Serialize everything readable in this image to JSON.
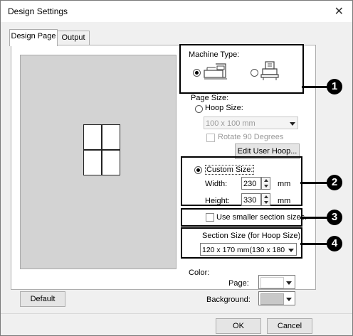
{
  "window": {
    "title": "Design Settings",
    "close_glyph": "✕"
  },
  "tabs": [
    {
      "label": "Design Page"
    },
    {
      "label": "Output"
    }
  ],
  "machine": {
    "label": "Machine Type:"
  },
  "page_size": {
    "label": "Page Size:",
    "hoop_label": "Hoop Size:",
    "hoop_value": "100 x 100 mm",
    "rotate_label": "Rotate 90 Degrees",
    "edit_hoop_button": "Edit User Hoop...",
    "custom_label": "Custom Size:",
    "width_label": "Width:",
    "width_value": "230",
    "height_label": "Height:",
    "height_value": "330",
    "unit": "mm"
  },
  "smaller_sections": {
    "label": "Use smaller section sizes."
  },
  "section_size": {
    "label": "Section Size (for Hoop Size):",
    "value": "120 x 170 mm(130 x 180 mm"
  },
  "color": {
    "label": "Color:",
    "page_label": "Page:",
    "background_label": "Background:",
    "page_color": "#ffffff",
    "background_color": "#c8c8c8"
  },
  "buttons": {
    "default": "Default",
    "ok": "OK",
    "cancel": "Cancel"
  },
  "callouts": [
    "1",
    "2",
    "3",
    "4"
  ]
}
